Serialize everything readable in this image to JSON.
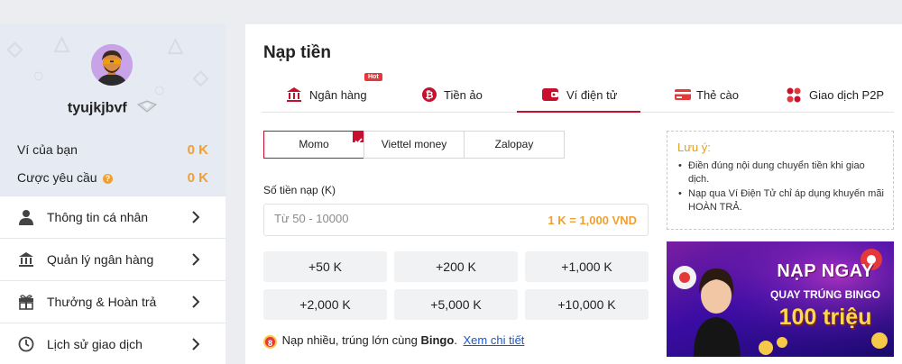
{
  "sidebar": {
    "username": "tyujkjbvf",
    "wallet_label": "Ví của bạn",
    "wallet_value": "0 K",
    "required_bet_label": "Cược yêu cầu",
    "required_bet_value": "0 K",
    "menu": [
      {
        "label": "Thông tin cá nhân",
        "icon": "person-icon"
      },
      {
        "label": "Quản lý ngân hàng",
        "icon": "bank-icon"
      },
      {
        "label": "Thưởng & Hoàn trả",
        "icon": "gift-icon"
      },
      {
        "label": "Lịch sử giao dịch",
        "icon": "history-icon"
      }
    ]
  },
  "main": {
    "title": "Nạp tiền",
    "tabs": [
      {
        "label": "Ngân hàng",
        "icon": "bank-icon",
        "badge": "Hot"
      },
      {
        "label": "Tiền ảo",
        "icon": "bitcoin-icon"
      },
      {
        "label": "Ví điện tử",
        "icon": "wallet-icon",
        "active": true
      },
      {
        "label": "Thẻ cào",
        "icon": "card-icon"
      },
      {
        "label": "Giao dịch P2P",
        "icon": "p2p-icon"
      }
    ],
    "wallets": [
      {
        "label": "Momo",
        "selected": true
      },
      {
        "label": "Viettel money"
      },
      {
        "label": "Zalopay"
      }
    ],
    "amount_label": "Số tiền nạp (K)",
    "amount_placeholder": "Từ 50 - 10000",
    "rate": "1 K = 1,000 VND",
    "quick_amounts": [
      "+50 K",
      "+200 K",
      "+1,000 K",
      "+2,000 K",
      "+5,000 K",
      "+10,000 K"
    ],
    "promo_text": "Nạp nhiều, trúng lớn cùng",
    "promo_bold": "Bingo",
    "promo_link": "Xem chi tiết"
  },
  "note": {
    "title": "Lưu ý:",
    "items": [
      "Điền đúng nội dung chuyển tiền khi giao dịch.",
      "Nạp qua Ví Điện Tử chỉ áp dụng khuyến mãi HOÀN TRẢ."
    ]
  },
  "banner": {
    "line1": "NẠP NGAY",
    "line2": "QUAY TRÚNG BINGO",
    "line3": "100 triệu"
  },
  "colors": {
    "accent": "#c8102e",
    "amount_orange": "#f0a030",
    "link_blue": "#1a56c9"
  }
}
